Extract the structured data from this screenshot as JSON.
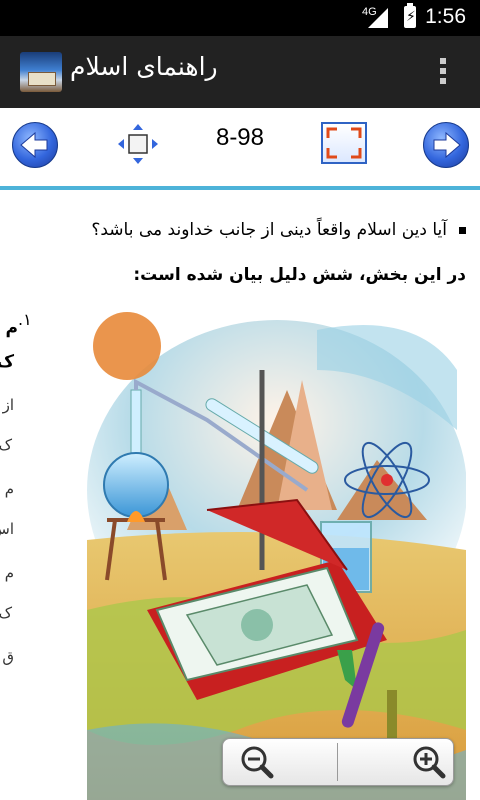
{
  "status_bar": {
    "network": "4G",
    "time": "1:56"
  },
  "app_bar": {
    "title": "راهنمای اسلام",
    "app_icon": "quran-globe-icon",
    "menu_icon": "overflow-menu-icon"
  },
  "nav": {
    "page_label": "8-98",
    "prev_icon": "arrow-left-icon",
    "next_icon": "arrow-right-icon",
    "move_icon": "move-arrows-icon",
    "fit_icon": "fit-screen-icon"
  },
  "content": {
    "bullet_text": "آیا دین اسلام واقعاً دینی از جانب خداوند می باشد؟",
    "subheading": "در این بخش، شش دلیل بیان شده است:",
    "list_number": "١.",
    "left_fragments": [
      "م",
      "ک",
      "از",
      "ک",
      "م",
      "اس",
      "م",
      "ک",
      "ق"
    ]
  },
  "zoom": {
    "zoom_out_icon": "zoom-out-icon",
    "zoom_in_icon": "zoom-in-icon"
  },
  "colors": {
    "accent_line": "#4db3d9",
    "action_bar": "#222222",
    "nav_button": "#3366dd"
  }
}
